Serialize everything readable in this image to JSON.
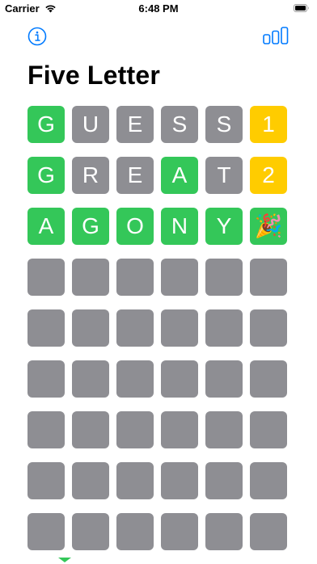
{
  "status_bar": {
    "carrier": "Carrier",
    "time": "6:48 PM"
  },
  "toolbar": {
    "info_icon": "info-circle-icon",
    "stats_icon": "bar-chart-icon",
    "accent_color": "#007aff"
  },
  "title": "Five Letter",
  "colors": {
    "correct": "#34c759",
    "absent": "#8e8e93",
    "count": "#ffcc00",
    "empty": "#8e8e93"
  },
  "board": {
    "rows": [
      {
        "letters": [
          {
            "letter": "G",
            "state": "green"
          },
          {
            "letter": "U",
            "state": "gray"
          },
          {
            "letter": "E",
            "state": "gray"
          },
          {
            "letter": "S",
            "state": "gray"
          },
          {
            "letter": "S",
            "state": "gray"
          }
        ],
        "result": {
          "text": "1",
          "state": "yellow"
        }
      },
      {
        "letters": [
          {
            "letter": "G",
            "state": "green"
          },
          {
            "letter": "R",
            "state": "gray"
          },
          {
            "letter": "E",
            "state": "gray"
          },
          {
            "letter": "A",
            "state": "green"
          },
          {
            "letter": "T",
            "state": "gray"
          }
        ],
        "result": {
          "text": "2",
          "state": "yellow"
        }
      },
      {
        "letters": [
          {
            "letter": "A",
            "state": "green"
          },
          {
            "letter": "G",
            "state": "green"
          },
          {
            "letter": "O",
            "state": "green"
          },
          {
            "letter": "N",
            "state": "green"
          },
          {
            "letter": "Y",
            "state": "green"
          }
        ],
        "result": {
          "text": "🎉",
          "state": "party"
        }
      },
      {
        "letters": [
          {
            "letter": "",
            "state": "empty"
          },
          {
            "letter": "",
            "state": "empty"
          },
          {
            "letter": "",
            "state": "empty"
          },
          {
            "letter": "",
            "state": "empty"
          },
          {
            "letter": "",
            "state": "empty"
          }
        ],
        "result": {
          "text": "",
          "state": "empty"
        }
      },
      {
        "letters": [
          {
            "letter": "",
            "state": "empty"
          },
          {
            "letter": "",
            "state": "empty"
          },
          {
            "letter": "",
            "state": "empty"
          },
          {
            "letter": "",
            "state": "empty"
          },
          {
            "letter": "",
            "state": "empty"
          }
        ],
        "result": {
          "text": "",
          "state": "empty"
        }
      },
      {
        "letters": [
          {
            "letter": "",
            "state": "empty"
          },
          {
            "letter": "",
            "state": "empty"
          },
          {
            "letter": "",
            "state": "empty"
          },
          {
            "letter": "",
            "state": "empty"
          },
          {
            "letter": "",
            "state": "empty"
          }
        ],
        "result": {
          "text": "",
          "state": "empty"
        }
      },
      {
        "letters": [
          {
            "letter": "",
            "state": "empty"
          },
          {
            "letter": "",
            "state": "empty"
          },
          {
            "letter": "",
            "state": "empty"
          },
          {
            "letter": "",
            "state": "empty"
          },
          {
            "letter": "",
            "state": "empty"
          }
        ],
        "result": {
          "text": "",
          "state": "empty"
        }
      },
      {
        "letters": [
          {
            "letter": "",
            "state": "empty"
          },
          {
            "letter": "",
            "state": "empty"
          },
          {
            "letter": "",
            "state": "empty"
          },
          {
            "letter": "",
            "state": "empty"
          },
          {
            "letter": "",
            "state": "empty"
          }
        ],
        "result": {
          "text": "",
          "state": "empty"
        }
      },
      {
        "letters": [
          {
            "letter": "",
            "state": "empty"
          },
          {
            "letter": "",
            "state": "empty"
          },
          {
            "letter": "",
            "state": "empty"
          },
          {
            "letter": "",
            "state": "empty"
          },
          {
            "letter": "",
            "state": "empty"
          }
        ],
        "result": {
          "text": "",
          "state": "empty"
        }
      }
    ]
  }
}
